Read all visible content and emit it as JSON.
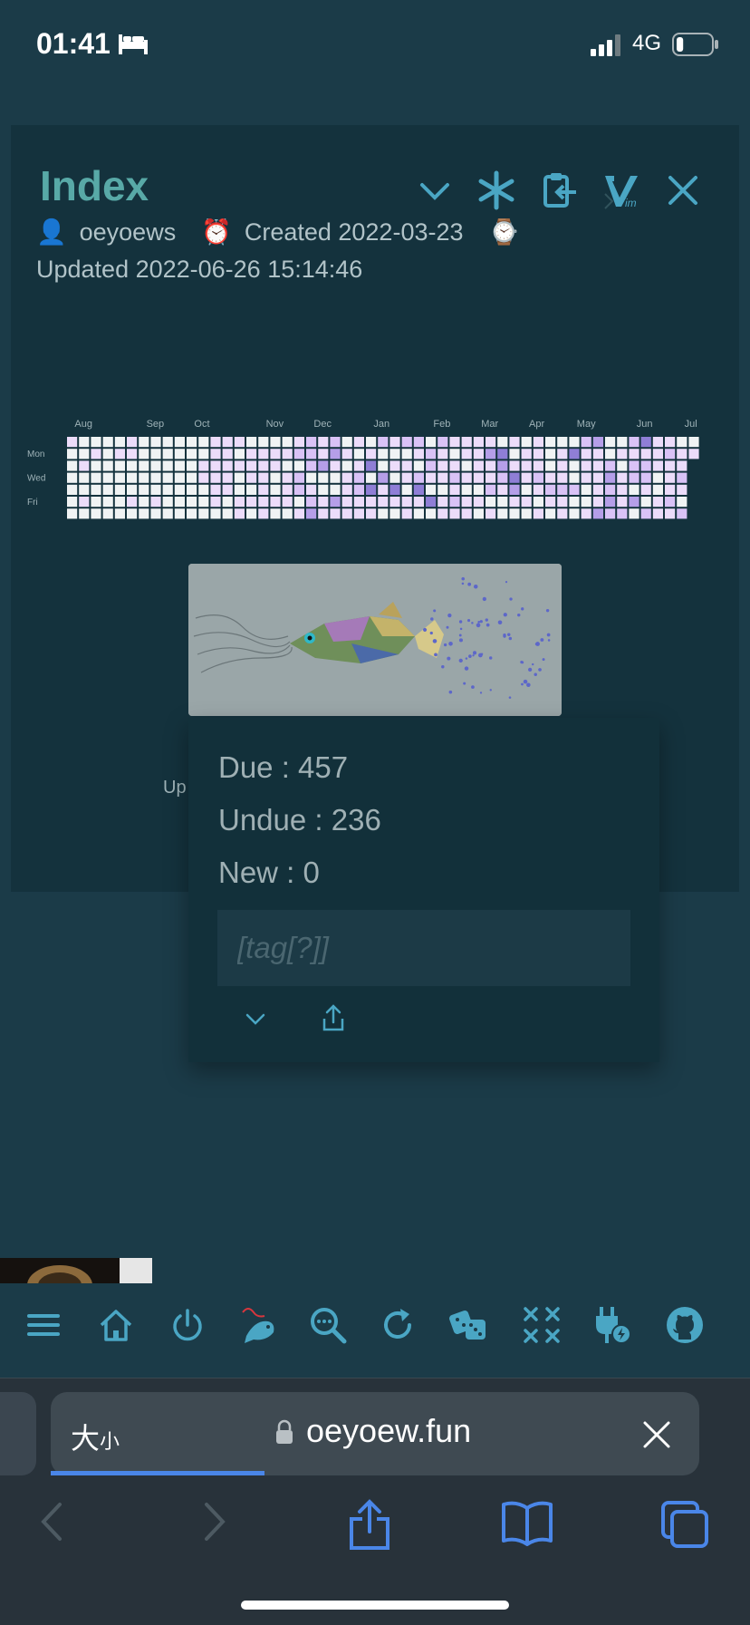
{
  "status_bar": {
    "time": "01:41",
    "network": "4G",
    "battery_level": 0.2,
    "icons": [
      "bed-icon",
      "signal-icon",
      "battery-icon"
    ]
  },
  "tiddler": {
    "title": "Index",
    "author_emoji": "👤",
    "author": "oeyoews",
    "created_emoji": "⏰",
    "created": "Created 2022-03-23",
    "watch_emoji": "⌚",
    "updated": "Updated 2022-06-26 15:14:46",
    "toolbar_icons": [
      "chevron-down-icon",
      "asterisk-icon",
      "clipboard-export-icon",
      "vim-icon",
      "close-icon"
    ]
  },
  "heatmap": {
    "months": [
      "Aug",
      "Sep",
      "Oct",
      "Nov",
      "Dec",
      "Jan",
      "Feb",
      "Mar",
      "Apr",
      "May",
      "Jun",
      "Jul"
    ],
    "day_labels": [
      "Mon",
      "Wed",
      "Fri"
    ],
    "weeks": 53,
    "colors": [
      "#f0f3f4",
      "#ecdcfa",
      "#d9c2f6",
      "#b59ee8",
      "#8f7ed6"
    ]
  },
  "review": {
    "due": "Due : 457",
    "undue": "Undue : 236",
    "new": "New : 0",
    "tag_placeholder": "[tag[?]]",
    "background_fragment": "Up"
  },
  "bottom_toolbar": {
    "icons": [
      "menu-icon",
      "home-icon",
      "power-icon",
      "fishing-icon",
      "search-icon",
      "refresh-icon",
      "dice-icon",
      "close-all-icon",
      "plugin-icon",
      "github-icon"
    ]
  },
  "browser": {
    "text_size_label": "大",
    "text_size_small": "小",
    "url": "oeyoew.fun",
    "load_progress": 0.33,
    "accent": "#4a86e8"
  },
  "colors": {
    "accent": "#58a9a7",
    "icon": "#4aa6c4",
    "background": "#1b3b48"
  }
}
